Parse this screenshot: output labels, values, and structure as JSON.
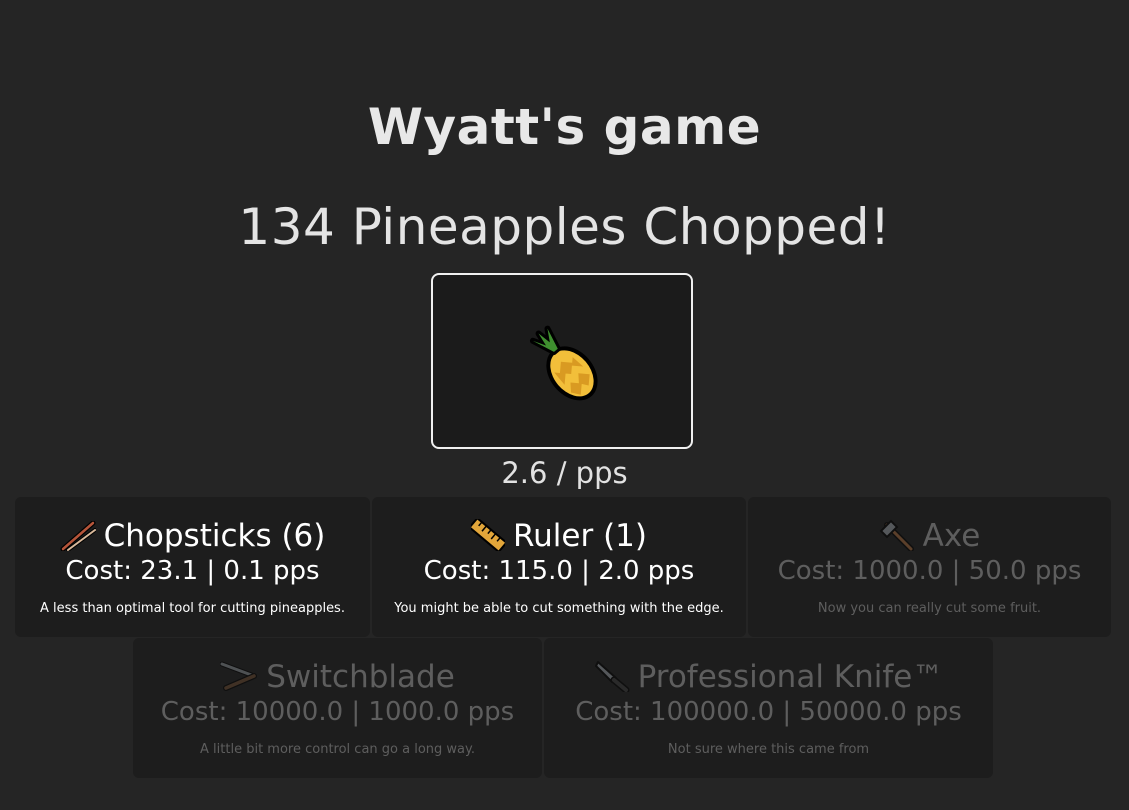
{
  "header": {
    "title": "Wyatt's game"
  },
  "counter": {
    "chopped_text": "134 Pineapples Chopped!"
  },
  "pineapple_button": {
    "icon": "pineapple-icon"
  },
  "rate": {
    "pps_text": "2.6 / pps"
  },
  "shop": {
    "items": [
      {
        "name": "Chopsticks (6)",
        "cost": "Cost: 23.1 | 0.1 pps",
        "description": "A less than optimal tool for cutting pineapples.",
        "icon": "chopsticks-icon",
        "enabled": true
      },
      {
        "name": "Ruler (1)",
        "cost": "Cost: 115.0 | 2.0 pps",
        "description": "You might be able to cut something with the edge.",
        "icon": "ruler-icon",
        "enabled": true
      },
      {
        "name": "Axe",
        "cost": "Cost: 1000.0 | 50.0 pps",
        "description": "Now you can really cut some fruit.",
        "icon": "axe-icon",
        "enabled": false
      },
      {
        "name": "Switchblade",
        "cost": "Cost: 10000.0 | 1000.0 pps",
        "description": "A little bit more control can go a long way.",
        "icon": "switchblade-icon",
        "enabled": false
      },
      {
        "name": "Professional Knife™",
        "cost": "Cost: 100000.0 | 50000.0 pps",
        "description": "Not sure where this came from",
        "icon": "knife-icon",
        "enabled": false
      }
    ]
  },
  "colors": {
    "background": "#252525",
    "card_background": "#1d1d1d",
    "enabled_text": "#ffffff",
    "disabled_text": "#5e5e5e",
    "pineapple_body": "#f2bf3a",
    "pineapple_leaves": "#3f8f2f"
  }
}
